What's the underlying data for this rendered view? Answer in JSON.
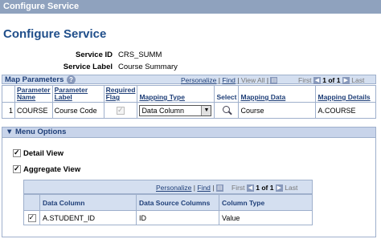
{
  "window": {
    "title": "Configure Service"
  },
  "page": {
    "title": "Configure Service"
  },
  "fields": {
    "service_id_label": "Service ID",
    "service_id_value": "CRS_SUMM",
    "service_label_label": "Service Label",
    "service_label_value": "Course Summary"
  },
  "map_params": {
    "title": "Map Parameters",
    "personalize": "Personalize",
    "find": "Find",
    "view_all": "View All",
    "first": "First",
    "range": "1 of 1",
    "last": "Last",
    "columns": [
      "Parameter Name",
      "Parameter Label",
      "Required Flag",
      "Mapping Type",
      "Select",
      "Mapping Data",
      "Mapping Details"
    ],
    "rows": [
      {
        "num": "1",
        "name": "COURSE",
        "label": "Course Code",
        "required": true,
        "mapping_type": "Data Column",
        "mapping_data": "Course",
        "mapping_details": "A.COURSE"
      }
    ]
  },
  "menu_options": {
    "title": "Menu Options",
    "detail_view": {
      "label": "Detail View",
      "checked": true
    },
    "aggregate_view": {
      "label": "Aggregate View",
      "checked": true
    },
    "grid": {
      "personalize": "Personalize",
      "find": "Find",
      "first": "First",
      "range": "1 of 1",
      "last": "Last",
      "columns": [
        "Data Column",
        "Data Source Columns",
        "Column Type"
      ],
      "rows": [
        {
          "checked": true,
          "data_column": "A.STUDENT_ID",
          "source": "ID",
          "type": "Value"
        }
      ]
    }
  }
}
